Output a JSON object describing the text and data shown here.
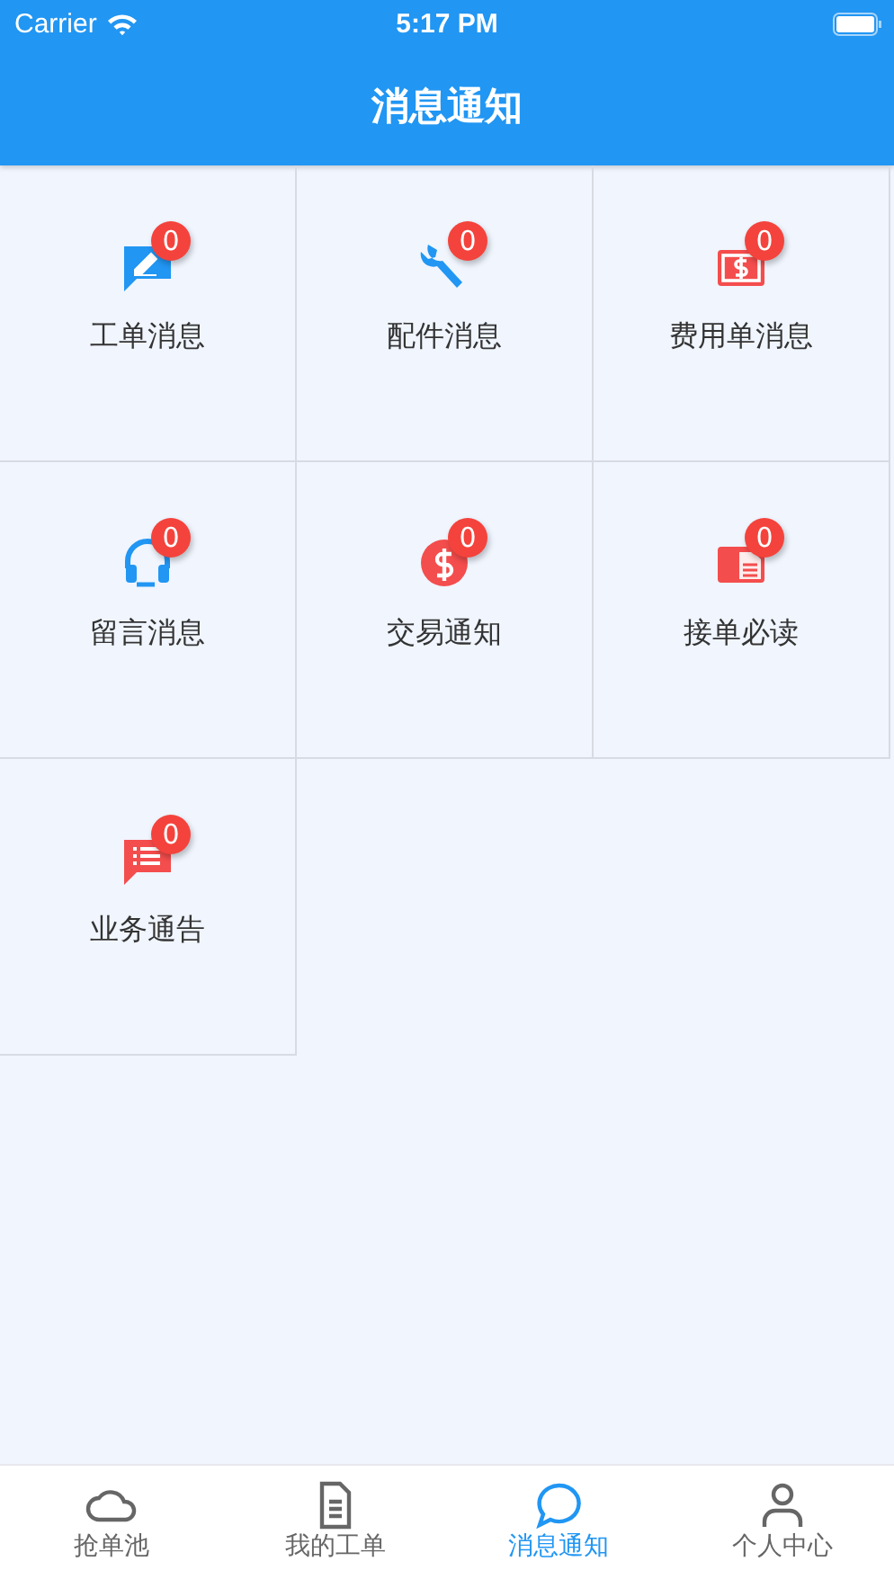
{
  "status_bar": {
    "carrier": "Carrier",
    "time": "5:17 PM"
  },
  "header": {
    "title": "消息通知"
  },
  "tiles": [
    {
      "label": "工单消息",
      "kind": "chat-pen",
      "color": "#2196f3",
      "badge": "0"
    },
    {
      "label": "配件消息",
      "kind": "wrench",
      "color": "#2196f3",
      "badge": "0"
    },
    {
      "label": "费用单消息",
      "kind": "bill",
      "color": "#f44d4d",
      "badge": "0"
    },
    {
      "label": "留言消息",
      "kind": "headset",
      "color": "#2196f3",
      "badge": "0"
    },
    {
      "label": "交易通知",
      "kind": "coin",
      "color": "#f44d4d",
      "badge": "0"
    },
    {
      "label": "接单必读",
      "kind": "doc",
      "color": "#f44d4d",
      "badge": "0"
    },
    {
      "label": "业务通告",
      "kind": "chat-list",
      "color": "#f44d4d",
      "badge": "0"
    }
  ],
  "tab_bar": [
    {
      "label": "抢单池",
      "kind": "cloud",
      "selected": false
    },
    {
      "label": "我的工单",
      "kind": "document",
      "selected": false
    },
    {
      "label": "消息通知",
      "kind": "bubble",
      "selected": true
    },
    {
      "label": "个人中心",
      "kind": "person",
      "selected": false
    }
  ]
}
